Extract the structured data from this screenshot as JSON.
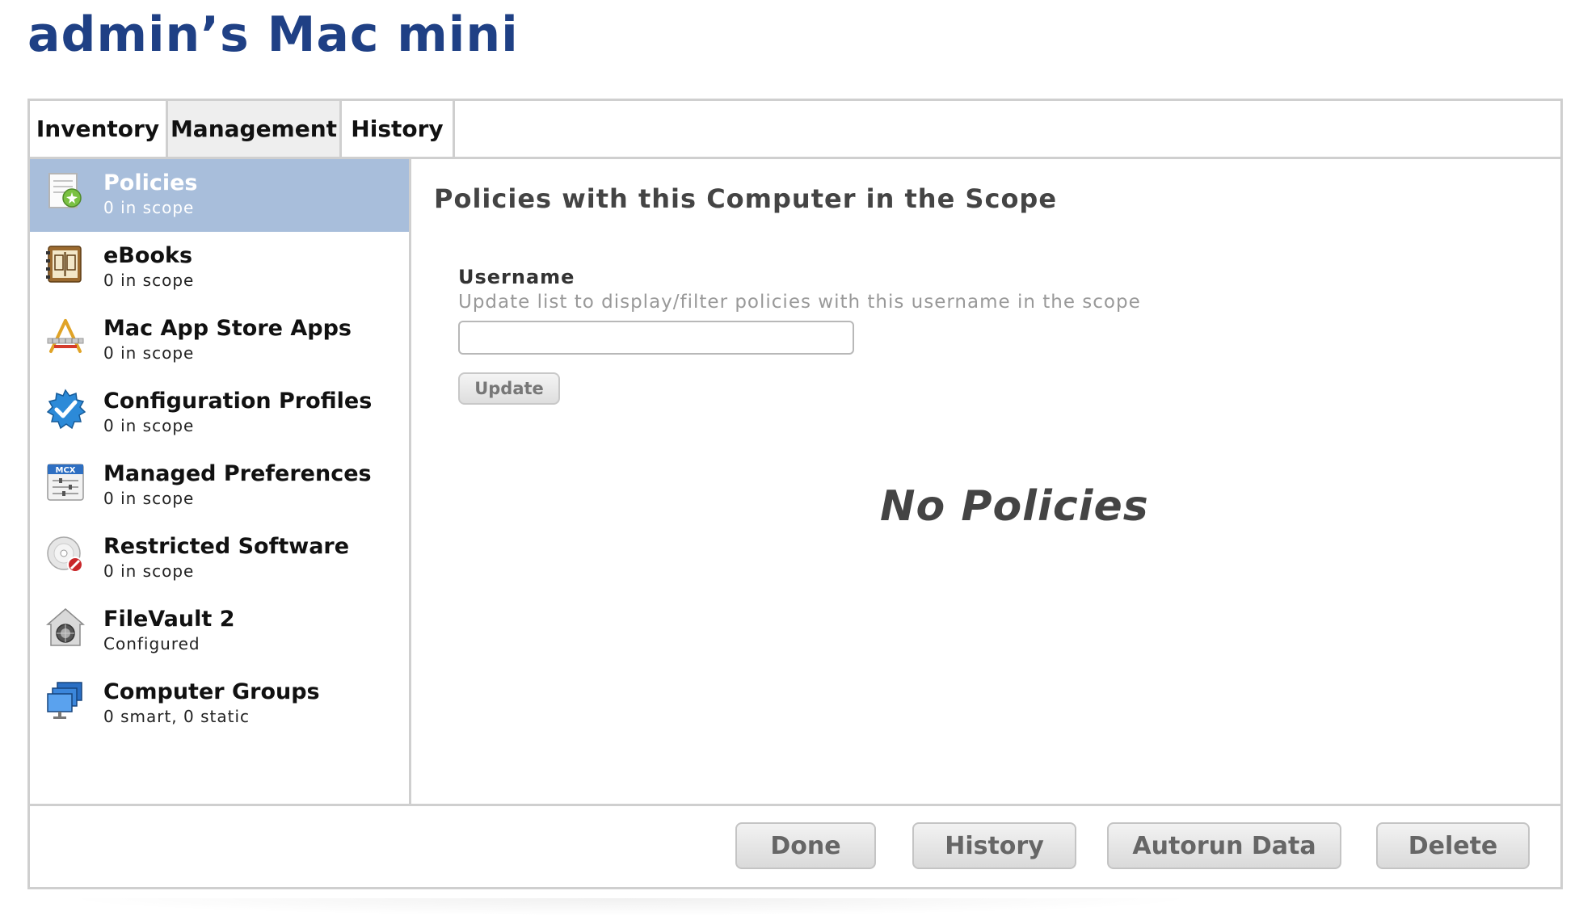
{
  "page": {
    "title": "admin’s Mac mini"
  },
  "tabs": [
    {
      "label": "Inventory"
    },
    {
      "label": "Management",
      "selected": true
    },
    {
      "label": "History"
    }
  ],
  "sidebar": {
    "items": [
      {
        "label": "Policies",
        "sub": "0 in scope",
        "icon": "policies-icon",
        "selected": true
      },
      {
        "label": "eBooks",
        "sub": "0 in scope",
        "icon": "ebook-icon"
      },
      {
        "label": "Mac App Store Apps",
        "sub": "0 in scope",
        "icon": "app-store-icon"
      },
      {
        "label": "Configuration Profiles",
        "sub": "0 in scope",
        "icon": "configuration-profile-icon"
      },
      {
        "label": "Managed Preferences",
        "sub": "0 in scope",
        "icon": "mcx-icon"
      },
      {
        "label": "Restricted Software",
        "sub": "0 in scope",
        "icon": "restricted-software-icon"
      },
      {
        "label": "FileVault 2",
        "sub": "Configured",
        "icon": "filevault-icon"
      },
      {
        "label": "Computer Groups",
        "sub": "0 smart, 0 static",
        "icon": "computer-groups-icon"
      }
    ]
  },
  "main": {
    "section_title": "Policies with this Computer in the Scope",
    "username": {
      "label": "Username",
      "help": "Update list to display/filter policies with this username in the scope",
      "value": "",
      "placeholder": ""
    },
    "update_button": "Update",
    "empty_message": "No Policies"
  },
  "footer": {
    "done": "Done",
    "history": "History",
    "autorun": "Autorun Data",
    "delete": "Delete"
  },
  "colors": {
    "title": "#1f4085",
    "selected_row": "#a8bedb",
    "border": "#cfcfcf"
  }
}
